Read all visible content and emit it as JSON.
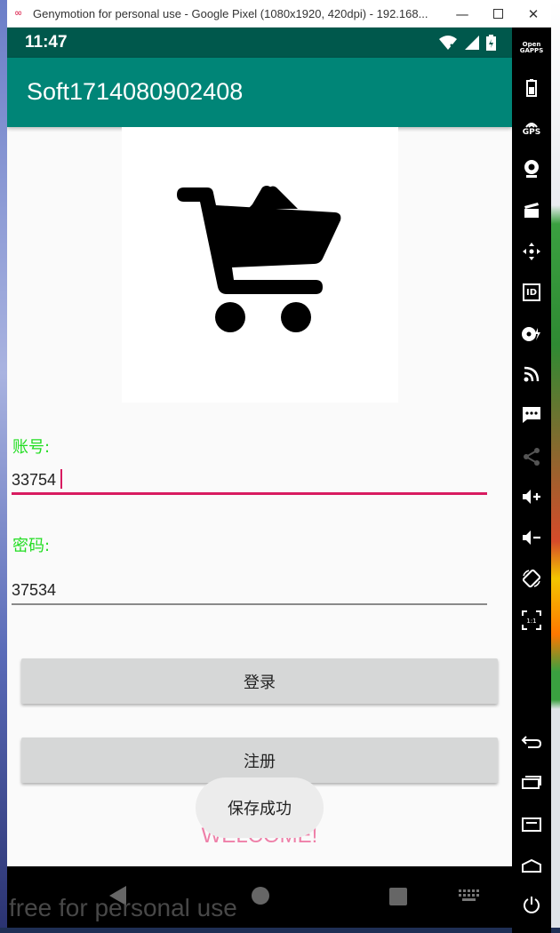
{
  "window": {
    "title": "Genymotion for personal use - Google Pixel (1080x1920, 420dpi) - 192.168...",
    "logo_icon": "genymotion-logo-icon",
    "minimize": "—",
    "close": "✕"
  },
  "status": {
    "time": "11:47",
    "icons": [
      "wifi-off-icon",
      "signal-icon",
      "battery-icon"
    ]
  },
  "app": {
    "title": "Soft1714080902408",
    "logo_icon": "shopping-cart-icon"
  },
  "form": {
    "account_label": "账号:",
    "account_value": "33754",
    "password_label": "密码:",
    "password_value": "37534",
    "login_button": "登录",
    "register_button": "注册"
  },
  "welcome": "WELCOME!",
  "toast": "保存成功",
  "watermark": "free for personal use",
  "toolbar": {
    "gapps_line1": "Open",
    "gapps_line2": "GAPPS",
    "gps": "GPS",
    "id": "ID",
    "ratio": "1:1",
    "icons": [
      "open-gapps-icon",
      "battery-icon",
      "gps-icon",
      "camera-icon",
      "clapperboard-icon",
      "dpad-icon",
      "id-icon",
      "disk-icon",
      "rss-icon",
      "sms-icon",
      "share-icon",
      "volume-up-icon",
      "volume-down-icon",
      "rotate-icon",
      "pixel-perfect-icon",
      "back-icon",
      "recents-icon",
      "menu-icon",
      "home-icon",
      "power-icon"
    ]
  },
  "colors": {
    "status_bar": "#00584c",
    "action_bar": "#008577",
    "accent": "#d81b60",
    "label": "#22dd22",
    "welcome": "#ee7fa8"
  }
}
